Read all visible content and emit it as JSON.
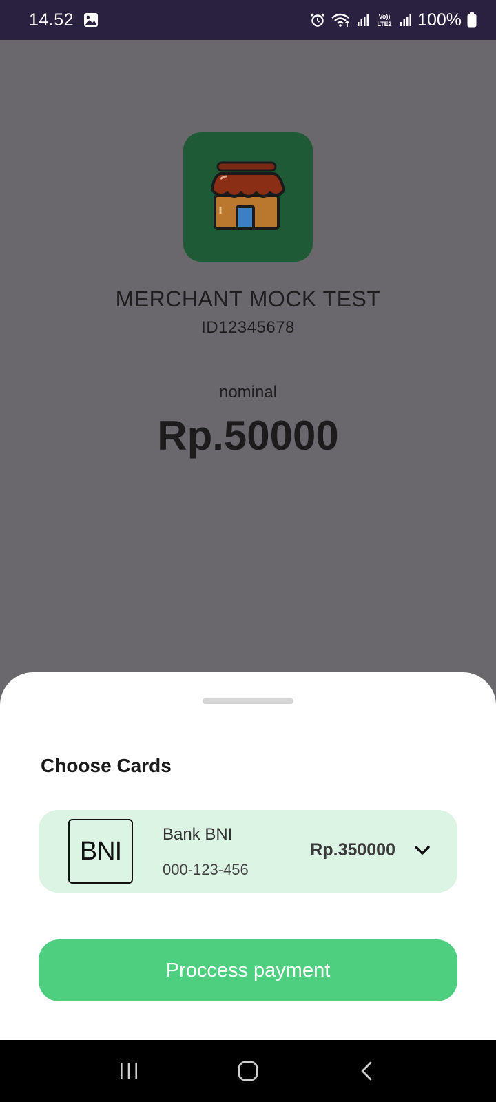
{
  "status_bar": {
    "time": "14.52",
    "battery": "100%",
    "icons": [
      "image-icon",
      "alarm-icon",
      "wifi-icon",
      "signal-icon",
      "volte-icon",
      "signal-icon",
      "battery-icon"
    ],
    "lte_label": "LTE2",
    "volte_label": "Vo))"
  },
  "merchant": {
    "name": "MERCHANT MOCK TEST",
    "id": "ID12345678",
    "logo_icon": "store-icon"
  },
  "payment": {
    "nominal_label": "nominal",
    "amount": "Rp.50000"
  },
  "sheet": {
    "title": "Choose Cards",
    "card": {
      "bank_logo_text": "BNI",
      "bank_name": "Bank BNI",
      "account_number": "000-123-456",
      "balance": "Rp.350000",
      "expand_icon": "chevron-down-icon"
    },
    "pay_button_label": "Proccess payment"
  },
  "nav_bar": {
    "icons": [
      "recent-apps-icon",
      "home-icon",
      "back-icon"
    ]
  },
  "colors": {
    "status_bar_bg": "#2a2040",
    "overlay_bg": "#6a686c",
    "merchant_logo_bg": "#1f5a37",
    "card_bg": "#dcf4e4",
    "pay_button_bg": "#4ecf7f"
  }
}
